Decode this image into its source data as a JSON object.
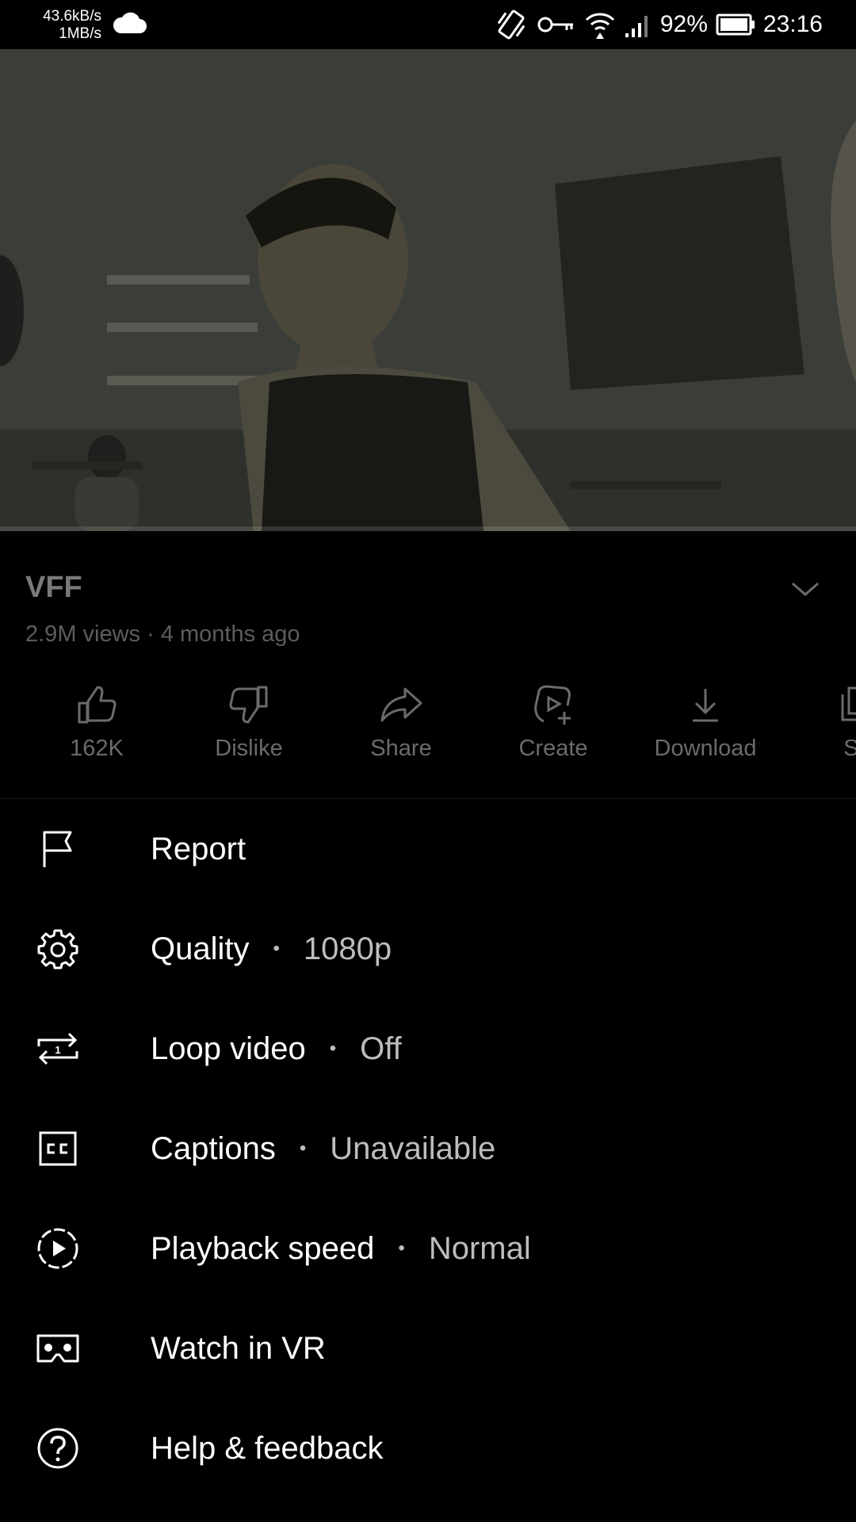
{
  "status_bar": {
    "net_up": "43.6kB/s",
    "net_down": "1MB/s",
    "battery": "92%",
    "time": "23:16",
    "icons": [
      "cloud-icon",
      "vibrate-icon",
      "vpn-key-icon",
      "wifi-icon",
      "signal-icon",
      "battery-icon"
    ]
  },
  "video": {
    "title": "VFF",
    "meta": "2.9M views · 4 months ago",
    "progress": 0.09
  },
  "actions": [
    {
      "label": "162K",
      "icon": "thumbs-up-icon"
    },
    {
      "label": "Dislike",
      "icon": "thumbs-down-icon"
    },
    {
      "label": "Share",
      "icon": "share-icon"
    },
    {
      "label": "Create",
      "icon": "create-icon"
    },
    {
      "label": "Download",
      "icon": "download-icon"
    },
    {
      "label": "Sa",
      "icon": "save-icon"
    }
  ],
  "menu": [
    {
      "label": "Report",
      "value": "",
      "icon": "flag-icon"
    },
    {
      "label": "Quality",
      "value": "1080p",
      "icon": "gear-icon"
    },
    {
      "label": "Loop video",
      "value": "Off",
      "icon": "loop-icon"
    },
    {
      "label": "Captions",
      "value": "Unavailable",
      "icon": "captions-icon"
    },
    {
      "label": "Playback speed",
      "value": "Normal",
      "icon": "playback-speed-icon"
    },
    {
      "label": "Watch in VR",
      "value": "",
      "icon": "vr-icon"
    },
    {
      "label": "Help & feedback",
      "value": "",
      "icon": "help-icon"
    }
  ],
  "separator": "•",
  "colors": {
    "background": "#000000",
    "text": "#ffffff",
    "dim_text": "#6b6b6b",
    "value_text": "#bdbdbd"
  }
}
